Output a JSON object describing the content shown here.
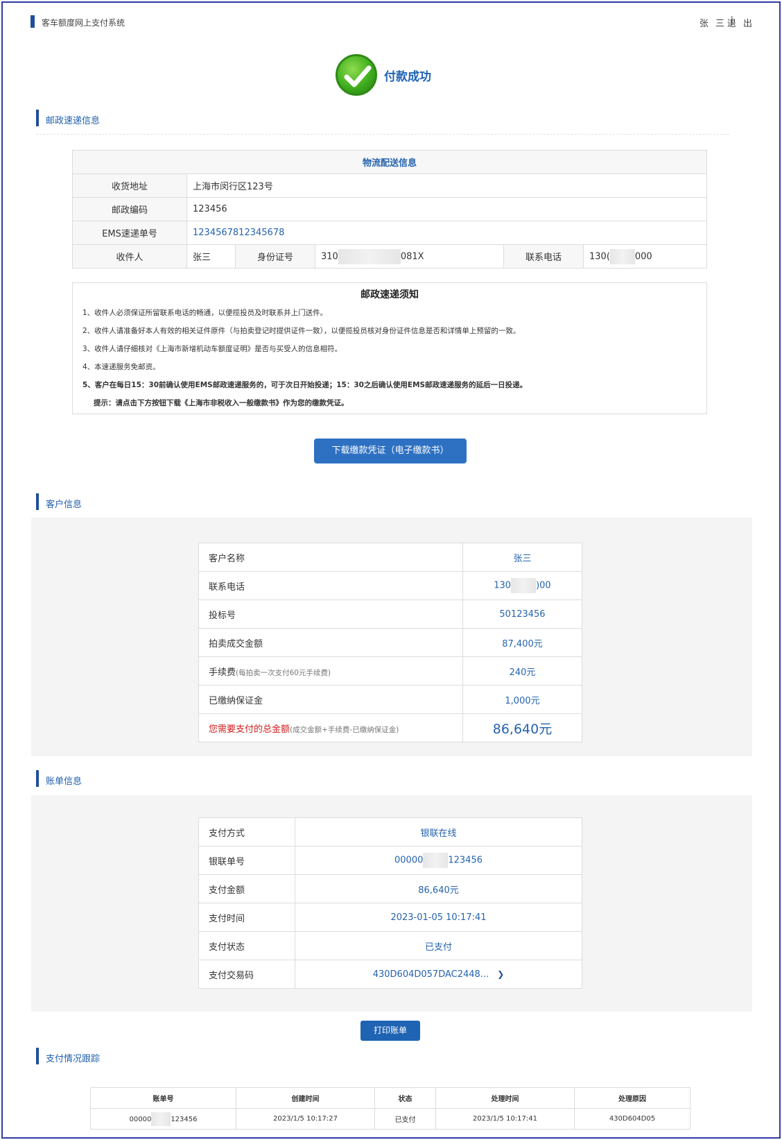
{
  "header": {
    "system_title": "客车额度网上支付系统",
    "user_name": "张 三",
    "separator": "|",
    "logout_label": "退 出"
  },
  "success": {
    "message": "付款成功"
  },
  "postal": {
    "section_title": "邮政速递信息",
    "table_title": "物流配送信息",
    "address_label": "收货地址",
    "address": "上海市闵行区123号",
    "zip_label": "邮政编码",
    "zip": "123456",
    "ems_label": "EMS速递单号",
    "ems": "1234567812345678",
    "recipient_label": "收件人",
    "recipient": "张三",
    "id_label": "身份证号",
    "id_prefix": "310",
    "id_suffix": "081X",
    "phone_label": "联系电话",
    "phone_prefix": "130(",
    "phone_suffix": "000"
  },
  "notice": {
    "title": "邮政速递须知",
    "items": [
      "1、收件人必须保证所留联系电话的畅通，以便揽投员及时联系并上门送件。",
      "2、收件人请准备好本人有效的相关证件原件（与拍卖登记时提供证件一致），以便揽投员核对身份证件信息是否和详情单上预留的一致。",
      "3、收件人请仔细核对《上海市新增机动车额度证明》是否与买受人的信息相符。",
      "4、本速递服务免邮资。",
      "5、客户在每日15：30前确认使用EMS邮政速递服务的，可于次日开始投递；15：30之后确认使用EMS邮政速递服务的延后一日投递。",
      "提示：请点击下方按钮下载《上海市非税收入一般缴款书》作为您的缴款凭证。"
    ],
    "download_button": "下载缴款凭证（电子缴款书）"
  },
  "customer": {
    "section_title": "客户信息",
    "name_label": "客户名称",
    "name": "张三",
    "phone_label": "联系电话",
    "phone_prefix": "130",
    "phone_suffix": ")00",
    "bid_label": "投标号",
    "bid": "50123456",
    "deal_label": "拍卖成交金额",
    "deal": "87,400元",
    "fee_label": "手续费",
    "fee_note": "(每拍卖一次支付60元手续费)",
    "fee": "240元",
    "deposit_label": "已缴纳保证金",
    "deposit": "1,000元",
    "total_label": "您需要支付的总金额",
    "total_note": "(成交金额+手续费-已缴纳保证金)",
    "total": "86,640元"
  },
  "bill": {
    "section_title": "账单信息",
    "method_label": "支付方式",
    "method": "银联在线",
    "unionpay_label": "银联单号",
    "unionpay_prefix": "00000",
    "unionpay_suffix": "123456",
    "amount_label": "支付金额",
    "amount": "86,640元",
    "time_label": "支付时间",
    "time": "2023-01-05 10:17:41",
    "status_label": "支付状态",
    "status": "已支付",
    "code_label": "支付交易码",
    "code": "430D604D057DAC2448...",
    "print_button": "打印账单"
  },
  "tracking": {
    "section_title": "支付情况跟踪",
    "columns": [
      "账单号",
      "创建时间",
      "状态",
      "处理时间",
      "处理原因"
    ],
    "row": {
      "bill_prefix": "00000",
      "bill_suffix": "123456",
      "created": "2023/1/5 10:17:27",
      "status": "已支付",
      "processed": "2023/1/5 10:17:41",
      "reason": "430D604D05"
    }
  },
  "colors": {
    "accent": "#1f63b3",
    "bar": "#1f4e9c",
    "success_green": "#3fae1e",
    "total_red": "#d21c1c"
  }
}
